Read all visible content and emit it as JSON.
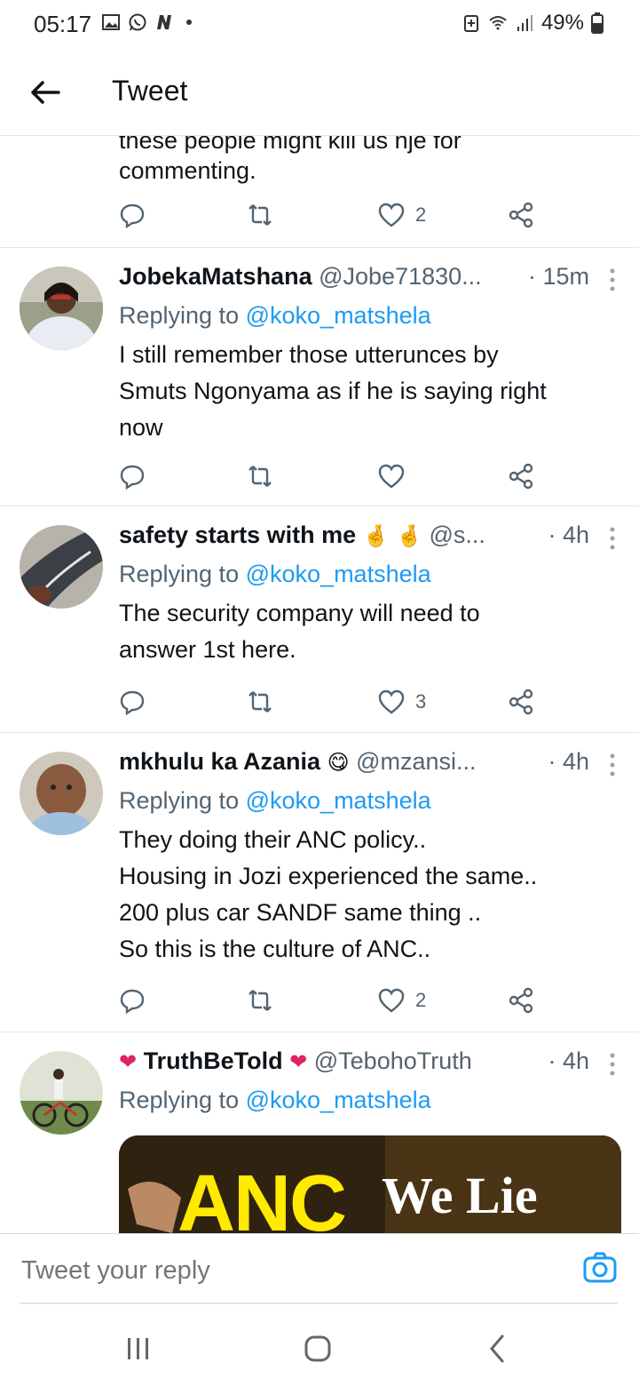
{
  "status_bar": {
    "time": "05:17",
    "battery": "49%",
    "icons": [
      "gallery-icon",
      "whatsapp-icon",
      "n-app-icon",
      "dot-icon",
      "battery-saver-icon",
      "wifi-icon",
      "signal-icon",
      "battery-icon"
    ]
  },
  "header": {
    "title": "Tweet",
    "back_icon": "arrow-left-icon"
  },
  "tweets": [
    {
      "partial_text": "these people might kill us nje for",
      "text_lines": [
        "commenting."
      ],
      "likes": "2"
    },
    {
      "name": "JobekaMatshana",
      "handle": "@Jobe71830...",
      "time": "· 15m",
      "replying_prefix": "Replying to",
      "replying_to": "@koko_matshela",
      "text_lines": [
        "I still remember those utterunces by",
        "Smuts Ngonyama as if he is saying right",
        "now"
      ],
      "likes": ""
    },
    {
      "name": "safety starts with me",
      "handle": "@s...",
      "time": "· 4h",
      "replying_prefix": "Replying to",
      "replying_to": "@koko_matshela",
      "text_lines": [
        "The security company will need to",
        "answer 1st here."
      ],
      "likes": "3"
    },
    {
      "name": "mkhulu ka Azania",
      "handle": "@mzansi...",
      "time": "· 4h",
      "replying_prefix": "Replying to",
      "replying_to": "@koko_matshela",
      "text_lines": [
        "They doing their ANC policy..",
        "Housing in Jozi experienced the same..",
        "200 plus car SANDF same thing ..",
        "So this is the culture of ANC.."
      ],
      "likes": "2"
    },
    {
      "name": "TruthBeTold",
      "handle": "@TebohoTruth",
      "time": "· 4h",
      "replying_prefix": "Replying to",
      "replying_to": "@koko_matshela",
      "media_text_left": "ANC",
      "media_text_right": "We Lie"
    }
  ],
  "reply_bar": {
    "placeholder": "Tweet your reply"
  },
  "colors": {
    "link": "#1d9bf0",
    "secondary": "#536471",
    "text": "#0f1419",
    "divider": "#e1e8ed"
  }
}
